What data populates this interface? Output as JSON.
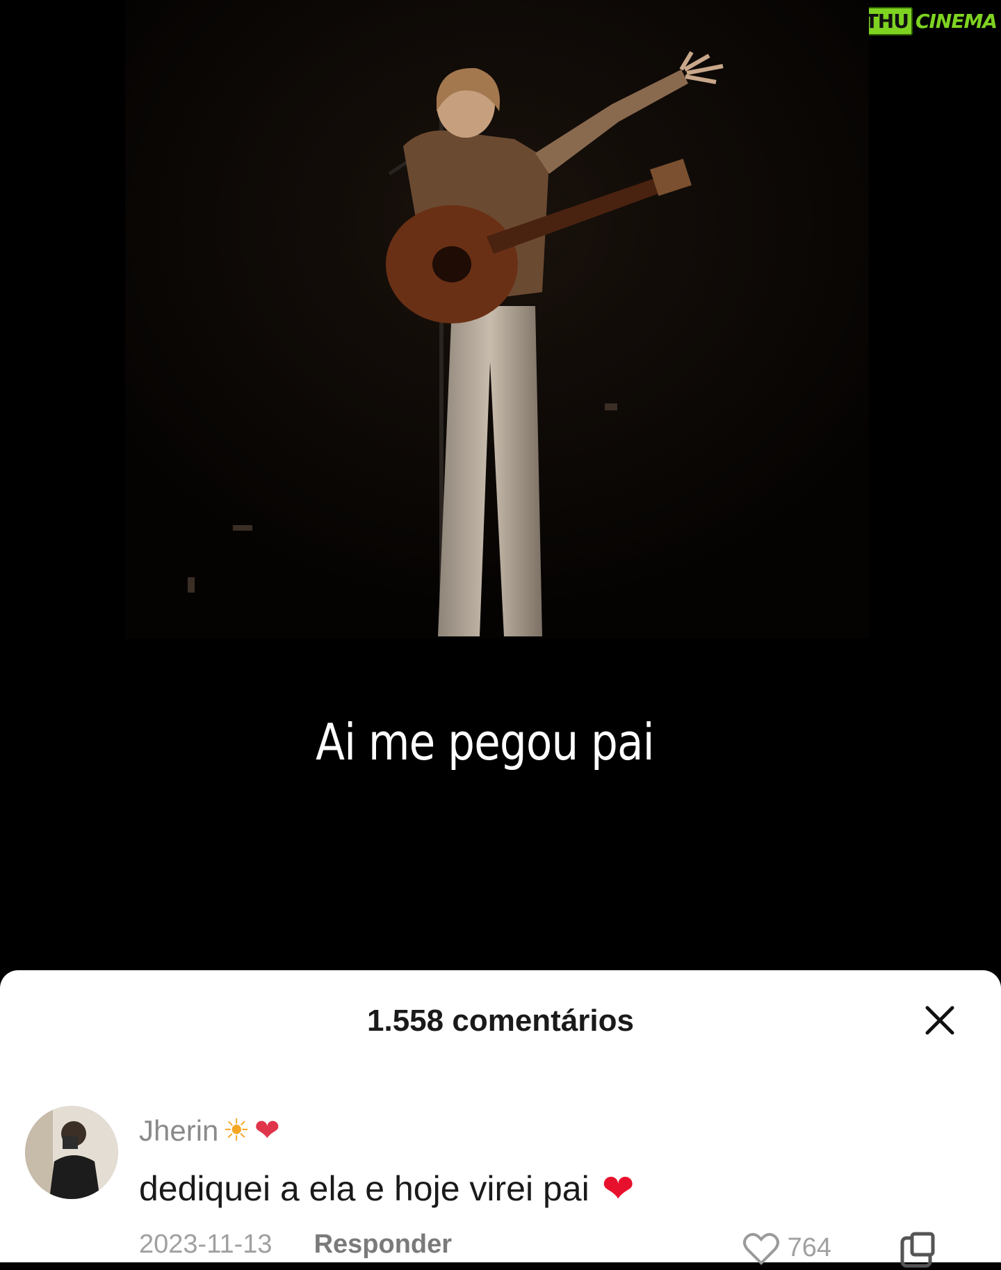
{
  "watermark": {
    "part1": "GETHU",
    "part2": "CINEMA"
  },
  "caption": "Ai me pegou pai",
  "comments_sheet": {
    "title": "1.558 comentários",
    "close_icon": "close-icon",
    "comment": {
      "username": "Jherin",
      "username_emojis": [
        "☀",
        "❤"
      ],
      "text": "dediquei a ela e hoje virei pai",
      "text_emoji": "❤",
      "date": "2023-11-13",
      "reply_label": "Responder",
      "like_count": "764"
    }
  },
  "colors": {
    "background": "#000000",
    "sheet": "#ffffff",
    "watermark_green": "#7ed321"
  }
}
